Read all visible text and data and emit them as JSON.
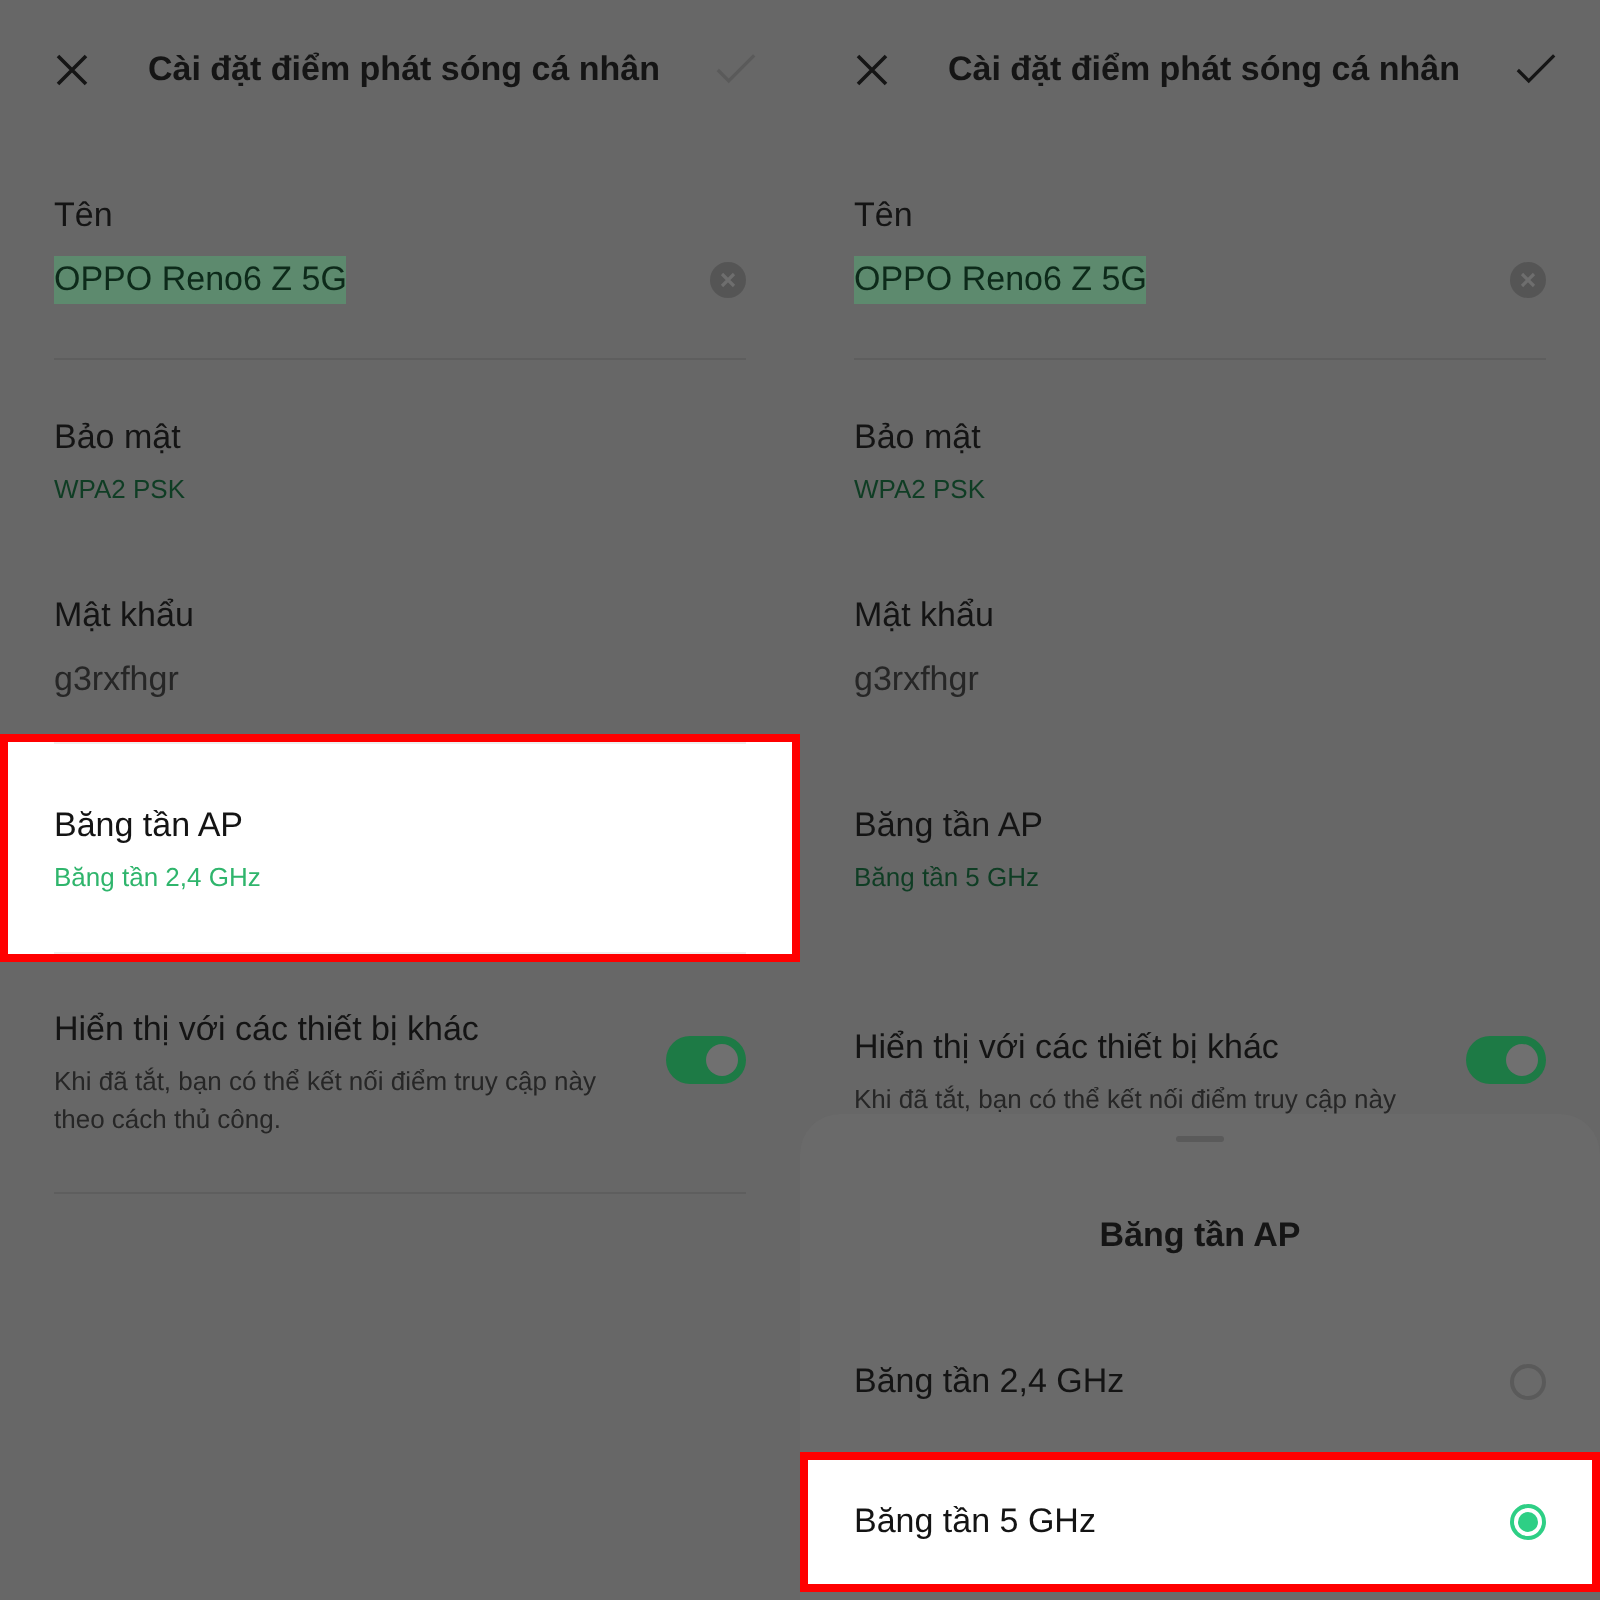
{
  "panels": [
    {
      "header": {
        "title": "Cài đặt điểm phát sóng cá nhân",
        "confirm_enabled": false
      },
      "name_field": {
        "label": "Tên",
        "value": "OPPO Reno6 Z 5G"
      },
      "security": {
        "label": "Bảo mật",
        "value": "WPA2 PSK"
      },
      "password": {
        "label": "Mật khẩu",
        "value": "g3rxfhgr"
      },
      "band": {
        "label": "Băng tần AP",
        "value": "Băng tần 2,4 GHz",
        "highlighted": true
      },
      "visibility": {
        "label": "Hiển thị với các thiết bị khác",
        "hint": "Khi đã tắt, bạn có thể kết nối điểm truy cập này theo cách thủ công.",
        "on": true
      }
    },
    {
      "header": {
        "title": "Cài đặt điểm phát sóng cá nhân",
        "confirm_enabled": true
      },
      "name_field": {
        "label": "Tên",
        "value": "OPPO Reno6 Z 5G"
      },
      "security": {
        "label": "Bảo mật",
        "value": "WPA2 PSK"
      },
      "password": {
        "label": "Mật khẩu",
        "value": "g3rxfhgr"
      },
      "band": {
        "label": "Băng tần AP",
        "value": "Băng tần 5 GHz",
        "highlighted": false
      },
      "visibility": {
        "label": "Hiển thị với các thiết bị khác",
        "hint": "Khi đã tắt, bạn có thể kết nối điểm truy cập này",
        "on": true
      },
      "sheet": {
        "title": "Băng tần AP",
        "options": [
          {
            "label": "Băng tần 2,4 GHz",
            "selected": false,
            "highlighted": false
          },
          {
            "label": "Băng tần 5 GHz",
            "selected": true,
            "highlighted": true
          }
        ]
      }
    }
  ]
}
